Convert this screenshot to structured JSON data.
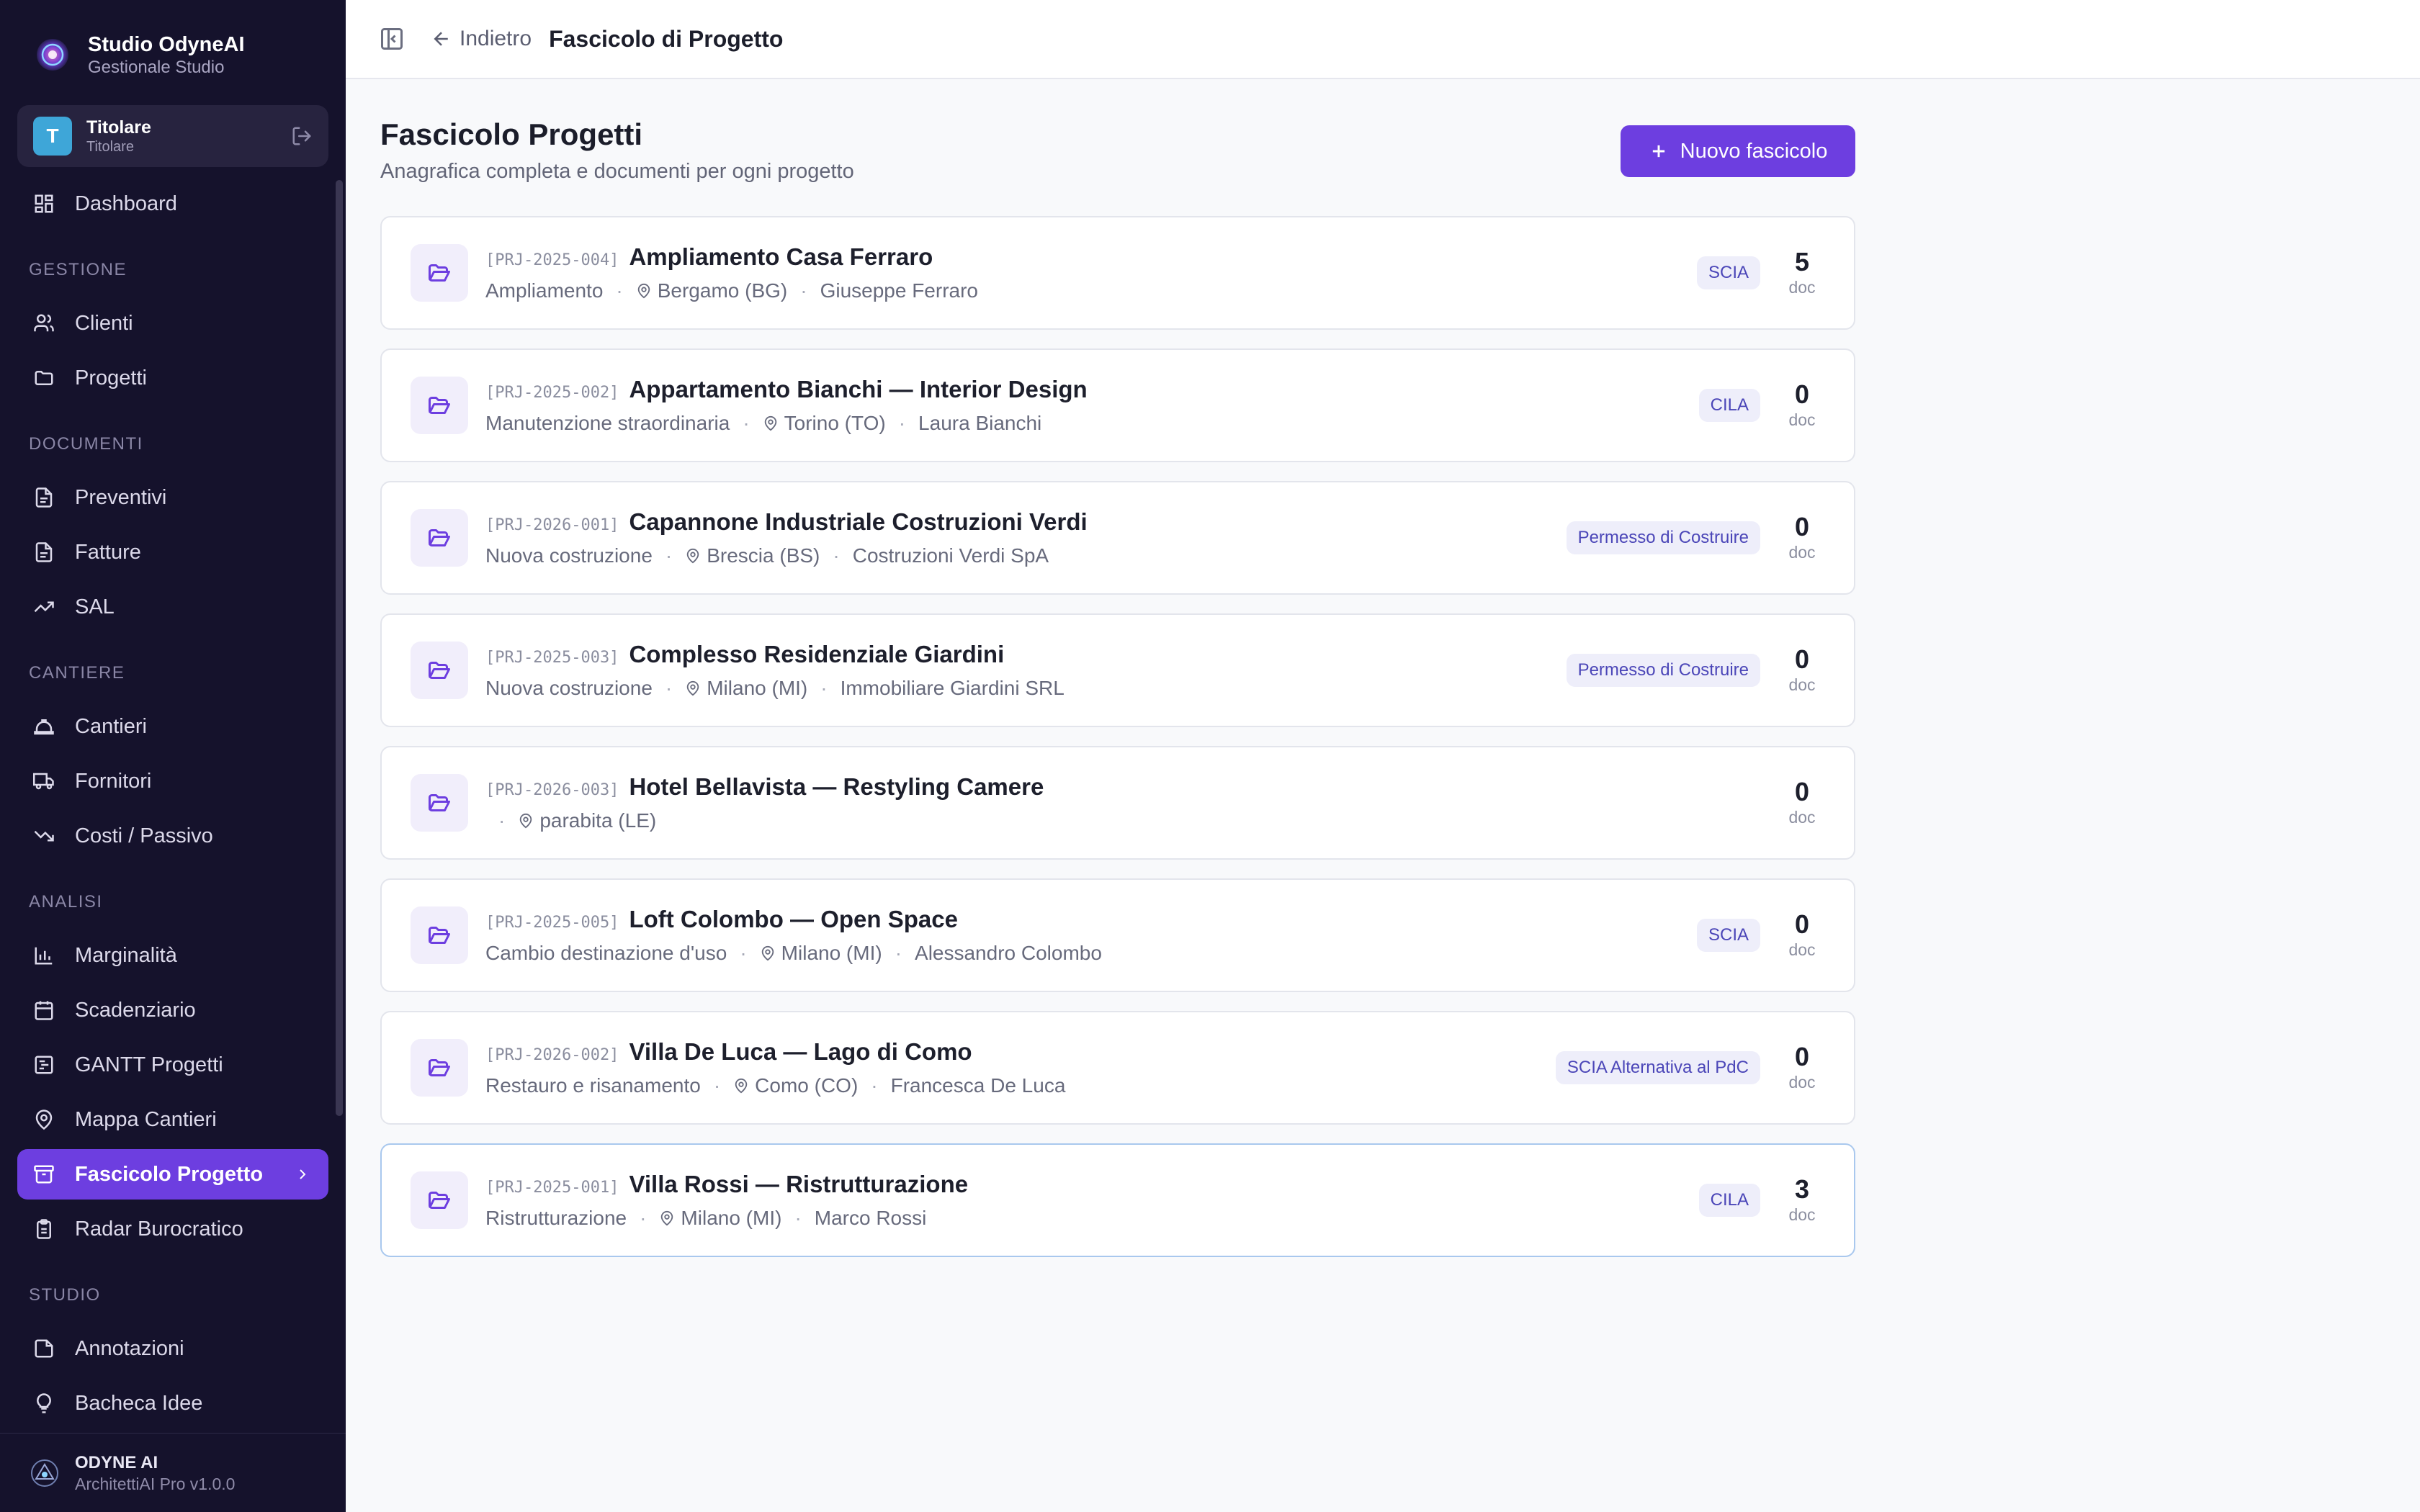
{
  "sidebar": {
    "brand": {
      "name": "Studio OdyneAI",
      "subtitle": "Gestionale Studio"
    },
    "user": {
      "initial": "T",
      "name": "Titolare",
      "role": "Titolare"
    },
    "items": [
      {
        "label": "Dashboard",
        "icon": "dashboard-icon"
      },
      {
        "section": "GESTIONE"
      },
      {
        "label": "Clienti",
        "icon": "users-icon"
      },
      {
        "label": "Progetti",
        "icon": "folder-icon"
      },
      {
        "section": "DOCUMENTI"
      },
      {
        "label": "Preventivi",
        "icon": "file-icon"
      },
      {
        "label": "Fatture",
        "icon": "file-icon"
      },
      {
        "label": "SAL",
        "icon": "trend-up-icon"
      },
      {
        "section": "CANTIERE"
      },
      {
        "label": "Cantieri",
        "icon": "hardhat-icon"
      },
      {
        "label": "Fornitori",
        "icon": "truck-icon"
      },
      {
        "label": "Costi / Passivo",
        "icon": "trend-down-icon"
      },
      {
        "section": "ANALISI"
      },
      {
        "label": "Marginalità",
        "icon": "bar-chart-icon"
      },
      {
        "label": "Scadenziario",
        "icon": "calendar-icon"
      },
      {
        "label": "GANTT Progetti",
        "icon": "gantt-icon"
      },
      {
        "label": "Mappa Cantieri",
        "icon": "map-pin-icon"
      },
      {
        "label": "Fascicolo Progetto",
        "icon": "archive-icon",
        "active": true
      },
      {
        "label": "Radar Burocratico",
        "icon": "clipboard-icon"
      },
      {
        "section": "STUDIO"
      },
      {
        "label": "Annotazioni",
        "icon": "note-icon"
      },
      {
        "label": "Bacheca Idee",
        "icon": "lightbulb-icon"
      }
    ],
    "footer": {
      "name": "ODYNE AI",
      "version": "ArchitettiAI Pro v1.0.0"
    }
  },
  "topbar": {
    "back_label": "Indietro",
    "title": "Fascicolo di Progetto"
  },
  "main": {
    "title": "Fascicolo Progetti",
    "subtitle": "Anagrafica completa e documenti per ogni progetto",
    "new_button": "Nuovo fascicolo",
    "doc_label": "doc",
    "projects": [
      {
        "code": "[PRJ-2025-004]",
        "name": "Ampliamento Casa Ferraro",
        "type": "Ampliamento",
        "location": "Bergamo (BG)",
        "client": "Giuseppe Ferraro",
        "badge": "SCIA",
        "docs": "5"
      },
      {
        "code": "[PRJ-2025-002]",
        "name": "Appartamento Bianchi — Interior Design",
        "type": "Manutenzione straordinaria",
        "location": "Torino (TO)",
        "client": "Laura Bianchi",
        "badge": "CILA",
        "docs": "0"
      },
      {
        "code": "[PRJ-2026-001]",
        "name": "Capannone Industriale Costruzioni Verdi",
        "type": "Nuova costruzione",
        "location": "Brescia (BS)",
        "client": "Costruzioni Verdi SpA",
        "badge": "Permesso di Costruire",
        "docs": "0"
      },
      {
        "code": "[PRJ-2025-003]",
        "name": "Complesso Residenziale Giardini",
        "type": "Nuova costruzione",
        "location": "Milano (MI)",
        "client": "Immobiliare Giardini SRL",
        "badge": "Permesso di Costruire",
        "docs": "0"
      },
      {
        "code": "[PRJ-2026-003]",
        "name": "Hotel Bellavista — Restyling Camere",
        "type": "",
        "location": "parabita (LE)",
        "client": "",
        "badge": "",
        "docs": "0"
      },
      {
        "code": "[PRJ-2025-005]",
        "name": "Loft Colombo — Open Space",
        "type": "Cambio destinazione d'uso",
        "location": "Milano (MI)",
        "client": "Alessandro Colombo",
        "badge": "SCIA",
        "docs": "0"
      },
      {
        "code": "[PRJ-2026-002]",
        "name": "Villa De Luca — Lago di Como",
        "type": "Restauro e risanamento",
        "location": "Como (CO)",
        "client": "Francesca De Luca",
        "badge": "SCIA Alternativa al PdC",
        "docs": "0"
      },
      {
        "code": "[PRJ-2025-001]",
        "name": "Villa Rossi — Ristrutturazione",
        "type": "Ristrutturazione",
        "location": "Milano (MI)",
        "client": "Marco Rossi",
        "badge": "CILA",
        "docs": "3",
        "highlight": true
      }
    ]
  }
}
